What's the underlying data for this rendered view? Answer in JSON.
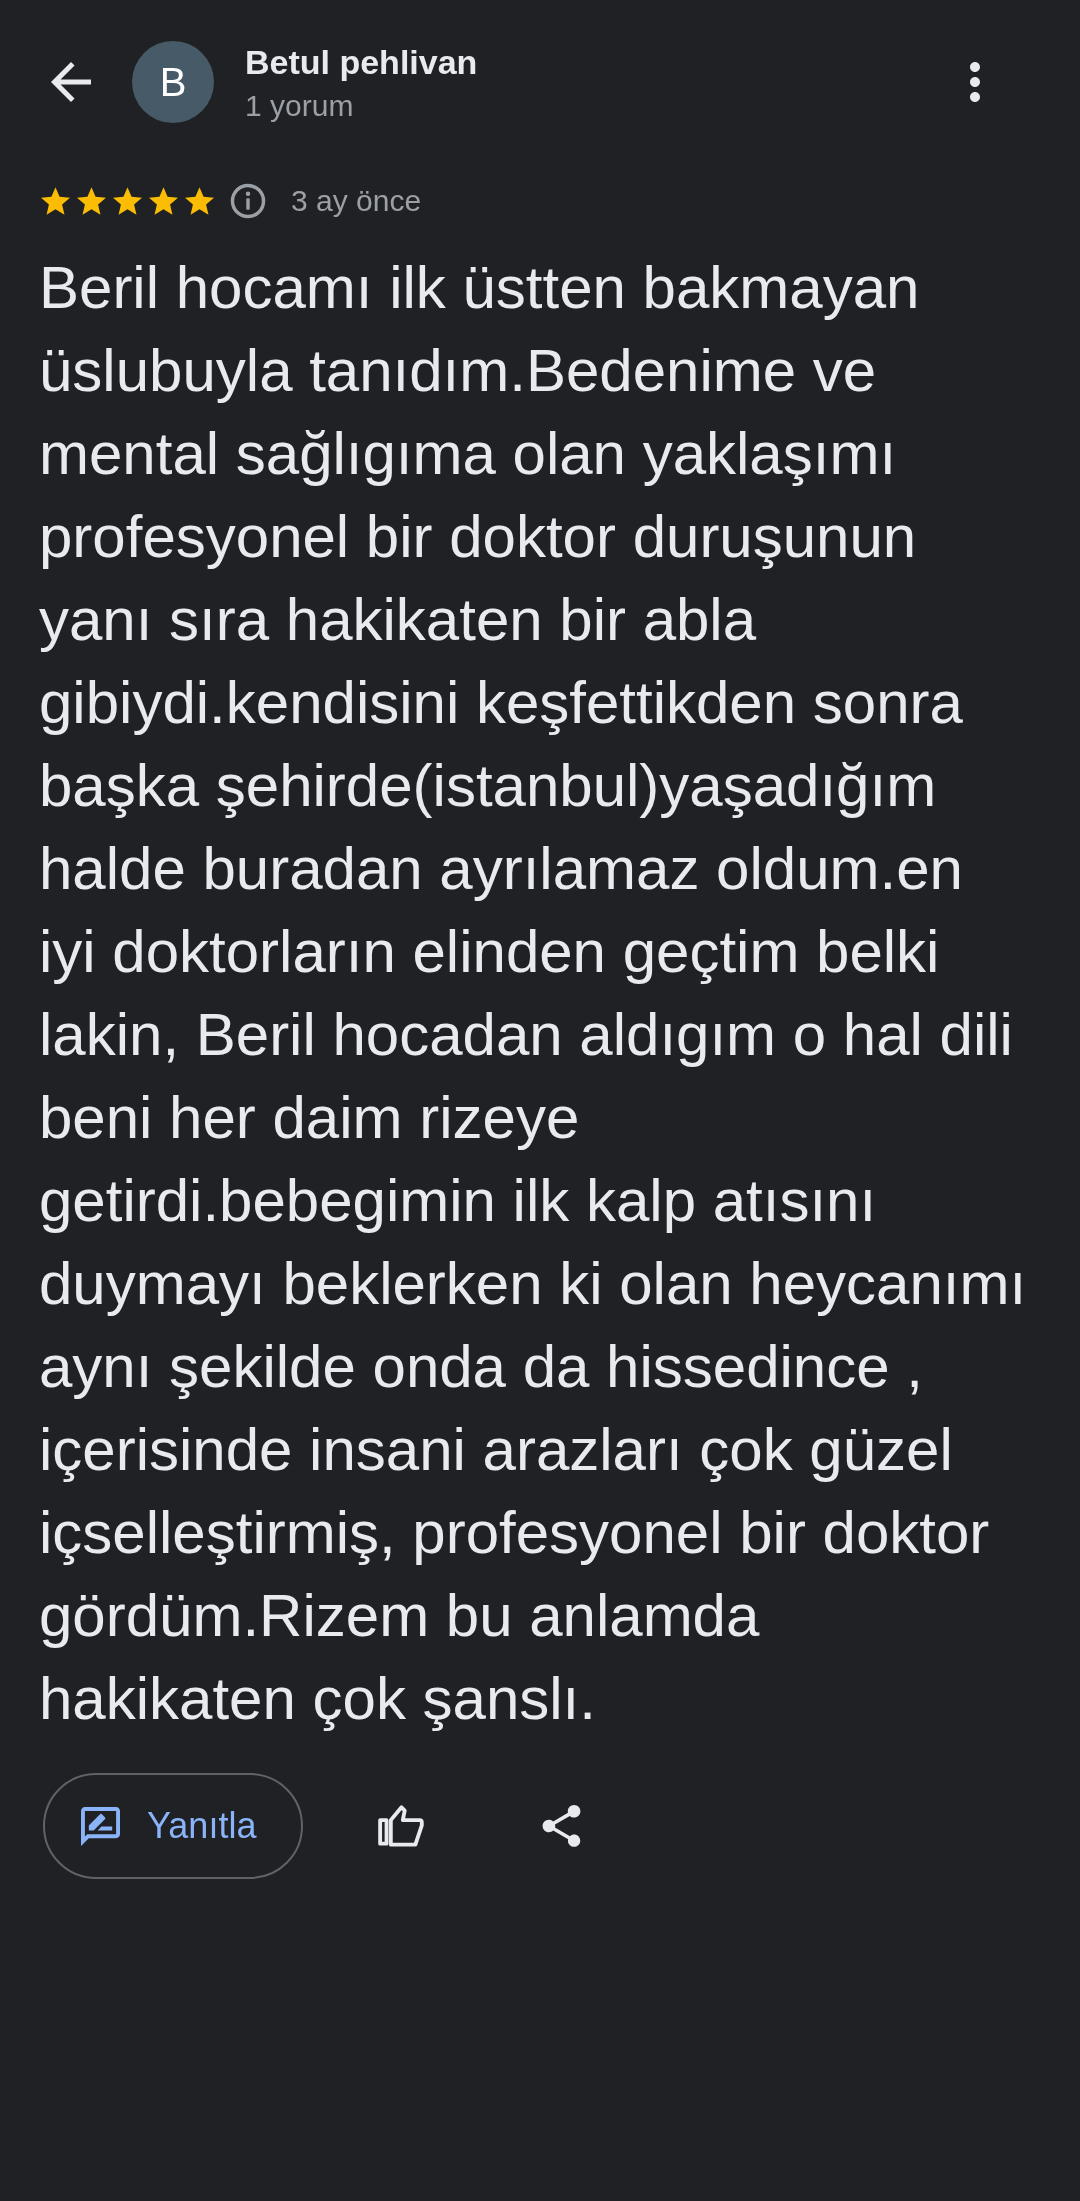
{
  "header": {
    "author": {
      "initial": "B",
      "name": "Betul pehlivan",
      "review_count": "1 yorum"
    }
  },
  "review": {
    "stars": 5,
    "time": "3 ay önce",
    "text_lines": [
      "Beril hocamı ilk üstten bakmayan",
      "üslubuyla tanıdım.Bedenime ve",
      "mental sağlıgıma olan yaklaşımı",
      "profesyonel bir doktor duruşunun",
      "yanı sıra hakikaten bir abla",
      "gibiydi.kendisini keşfettikden sonra",
      "başka şehirde(istanbul)yaşadığım",
      "halde buradan ayrılamaz oldum.en",
      "iyi doktorların elinden geçtim belki",
      "lakin, Beril hocadan aldıgım o hal dili",
      "beni her daim rizeye",
      "getirdi.bebegimin ilk kalp atısını",
      "duymayı beklerken ki olan heycanımı",
      "aynı şekilde onda da hissedince ,",
      "içerisinde insani arazları çok güzel",
      "içselleştirmiş, profesyonel bir doktor",
      "gördüm.Rizem bu anlamda",
      "hakikaten çok şanslı."
    ]
  },
  "actions": {
    "reply": {
      "label": "Yanıtla"
    }
  }
}
